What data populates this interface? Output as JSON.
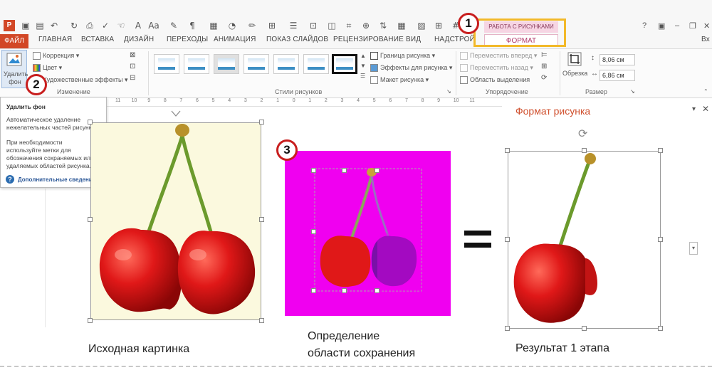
{
  "titlebar": {
    "window_controls": [
      "?",
      "▣",
      "–",
      "❐",
      "✕"
    ]
  },
  "tabs": {
    "file": "ФАЙЛ",
    "items": [
      "ГЛАВНАЯ",
      "ВСТАВКА",
      "ДИЗАЙН",
      "ПЕРЕХОДЫ",
      "АНИМАЦИЯ",
      "ПОКАЗ СЛАЙДОВ",
      "РЕЦЕНЗИРОВАНИЕ",
      "ВИД",
      "НАДСТРОЙ"
    ],
    "user": "Вх",
    "context_header": "РАБОТА С РИСУНКАМИ",
    "context_tab": "ФОРМАТ"
  },
  "ribbon": {
    "remove_bg": "Удалить фон",
    "corrections": "Коррекция ▾",
    "color": "Цвет ▾",
    "artistic": "Художественные эффекты ▾",
    "group_adjust": "Изменение",
    "group_styles": "Стили рисунков",
    "border": "Граница рисунка ▾",
    "effects": "Эффекты для рисунка ▾",
    "layout": "Макет рисунка ▾",
    "bring_forward": "Переместить вперед ▾",
    "send_backward": "Переместить назад ▾",
    "selection_pane": "Область выделения",
    "group_arrange": "Упорядочение",
    "crop": "Обрезка",
    "height": "8,06 см",
    "width": "6,86 см",
    "group_size": "Размер"
  },
  "tooltip": {
    "title": "Удалить фон",
    "line1": "Автоматическое удаление",
    "line2": "нежелательных частей рисунка.",
    "line3": "При необходимости",
    "line4": "используйте метки для",
    "line5": "обозначения сохраняемых или",
    "line6": "удаляемых областей рисунка.",
    "more": "Дополнительные сведения"
  },
  "ruler_ticks": [
    "11",
    "10",
    "9",
    "8",
    "7",
    "6",
    "5",
    "4",
    "3",
    "2",
    "1",
    "0",
    "1",
    "2",
    "3",
    "4",
    "5",
    "6",
    "7",
    "8",
    "9",
    "10",
    "11"
  ],
  "pane": {
    "title": "Формат рисунка"
  },
  "badges": [
    "1",
    "2",
    "3"
  ],
  "captions": {
    "original": "Исходная картинка",
    "detect_1": "Определение",
    "detect_2": "области сохранения",
    "result": "Результат 1 этапа"
  },
  "colors": {
    "file_tab": "#d24726",
    "context_highlight": "#f2b92a",
    "badge_ring": "#c81e1e",
    "magenta_bg": "#f000f0",
    "cherry_red": "#e01818"
  }
}
